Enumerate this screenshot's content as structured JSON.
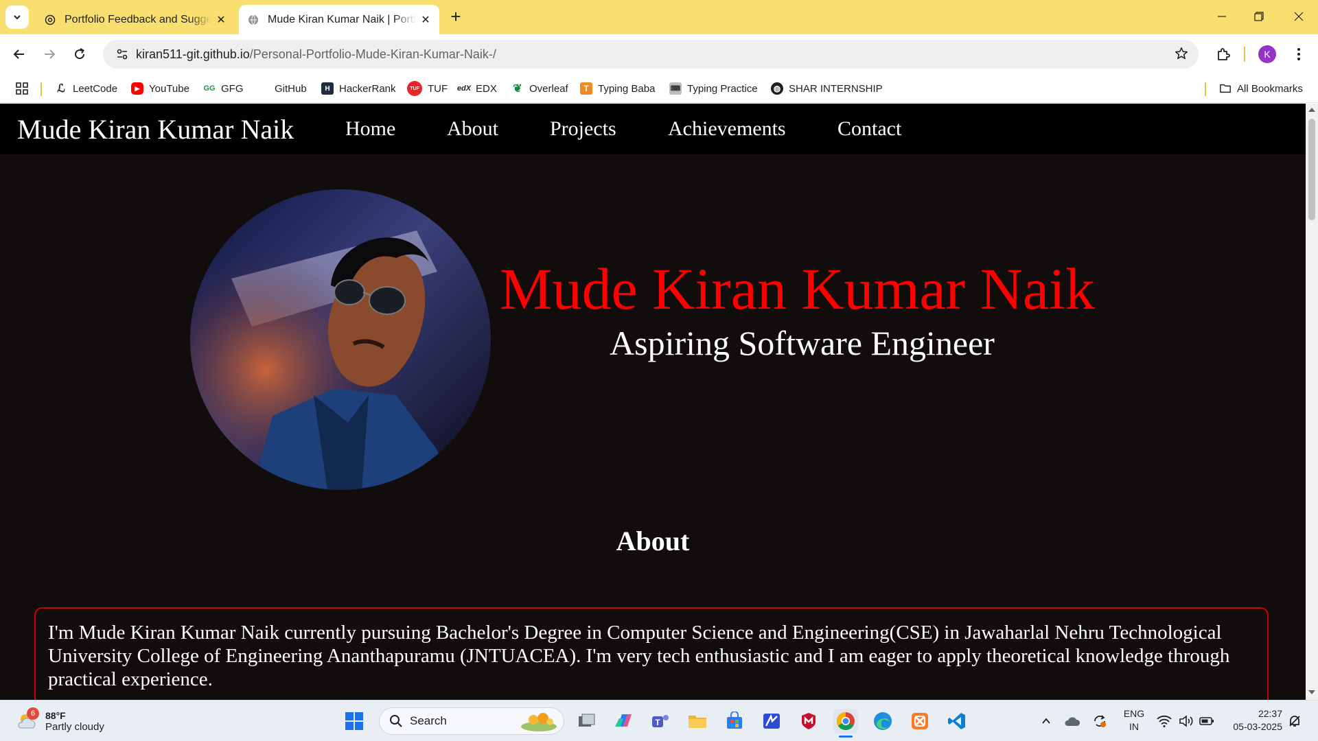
{
  "browser": {
    "tabs": [
      {
        "title": "Portfolio Feedback and Suggest",
        "active": false
      },
      {
        "title": "Mude Kiran Kumar Naik | Portfo",
        "active": true
      }
    ],
    "address": {
      "host": "kiran511-git.github.io",
      "path": "/Personal-Portfolio-Mude-Kiran-Kumar-Naik-/"
    },
    "profile_initial": "K",
    "bookmarks": [
      {
        "label": "LeetCode",
        "icon": "leetcode-icon"
      },
      {
        "label": "YouTube",
        "icon": "youtube-icon"
      },
      {
        "label": "GFG",
        "icon": "gfg-icon"
      },
      {
        "label": "GitHub",
        "icon": "github-icon"
      },
      {
        "label": "HackerRank",
        "icon": "hackerrank-icon"
      },
      {
        "label": "TUF",
        "icon": "tuf-icon"
      },
      {
        "label": "EDX",
        "icon": "edx-icon"
      },
      {
        "label": "Overleaf",
        "icon": "overleaf-icon"
      },
      {
        "label": "Typing Baba",
        "icon": "typingbaba-icon"
      },
      {
        "label": "Typing Practice",
        "icon": "typing-practice-icon"
      },
      {
        "label": "SHAR INTERNSHIP",
        "icon": "globe-icon"
      }
    ],
    "all_bookmarks_label": "All Bookmarks",
    "colors": {
      "tabbar": "#f9df6f",
      "omnibox": "#efeff0",
      "profile": "#9334c4"
    }
  },
  "site": {
    "brand": "Mude Kiran Kumar Naik",
    "nav": [
      "Home",
      "About",
      "Projects",
      "Achievements",
      "Contact"
    ],
    "hero": {
      "name": "Mude Kiran Kumar Naik",
      "role": "Aspiring Software Engineer"
    },
    "about": {
      "heading": "About",
      "text": "I'm Mude Kiran Kumar Naik currently pursuing Bachelor's Degree in Computer Science and Engineering(CSE) in Jawaharlal Nehru Technological University College of Engineering Ananthapuramu (JNTUACEA). I'm very tech enthusiastic and I am eager to apply theoretical knowledge through practical experience."
    },
    "colors": {
      "background": "#110d0d",
      "navbar": "#000000",
      "accent": "#ff0000"
    }
  },
  "taskbar": {
    "weather": {
      "badge": "6",
      "temp": "88°F",
      "condition": "Partly cloudy"
    },
    "search_label": "Search",
    "language": {
      "line1": "ENG",
      "line2": "IN"
    },
    "clock": {
      "time": "22:37",
      "date": "05-03-2025"
    }
  }
}
